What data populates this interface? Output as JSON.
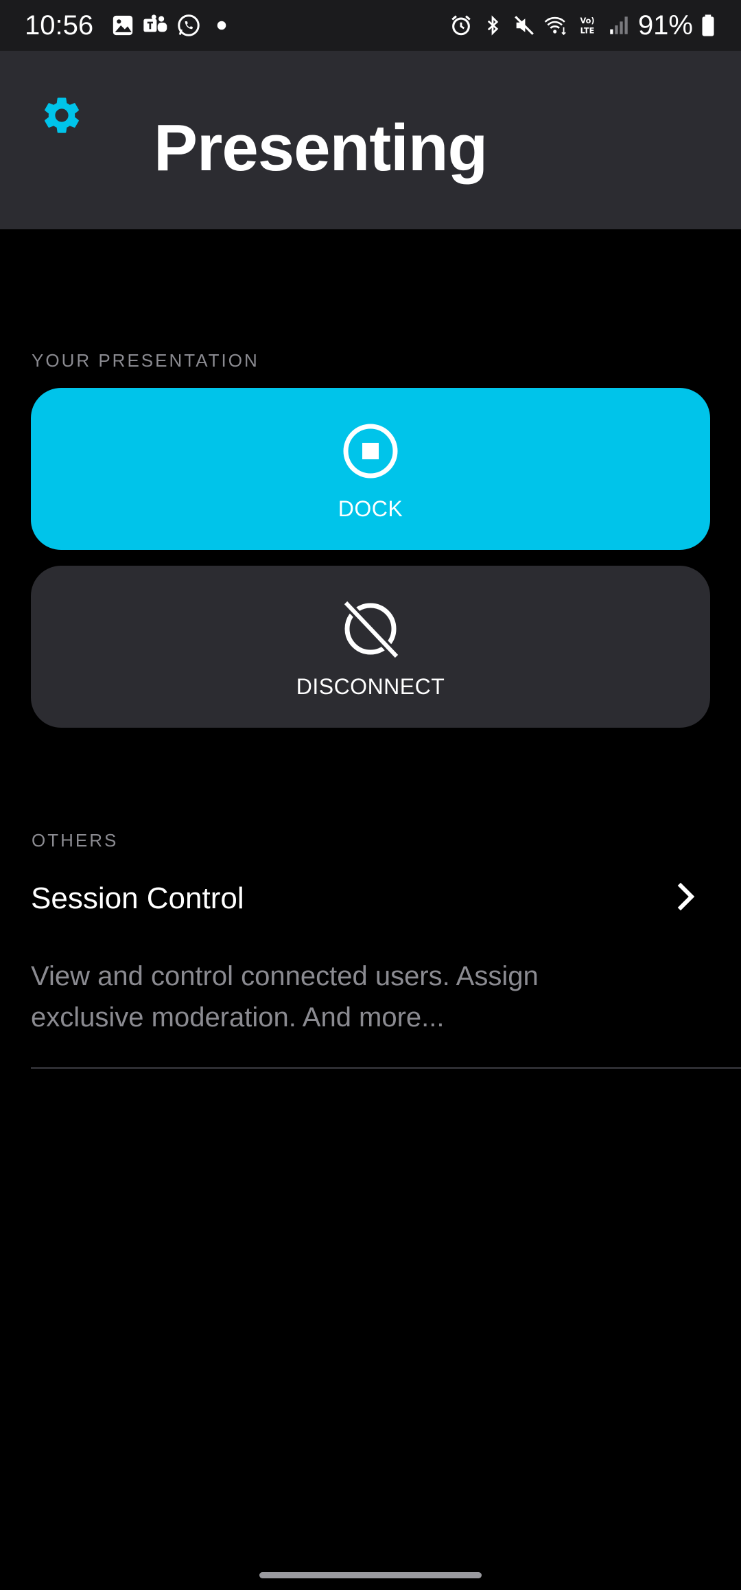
{
  "status_bar": {
    "time": "10:56",
    "battery_percent": "91%",
    "left_icons": [
      "gallery-icon",
      "teams-icon",
      "whatsapp-icon",
      "dot-icon"
    ],
    "right_icons": [
      "alarm-icon",
      "bluetooth-icon",
      "mute-icon",
      "wifi-icon",
      "volte-icon",
      "signal-icon",
      "battery-icon"
    ]
  },
  "header": {
    "title": "Presenting",
    "settings_icon": "gear-icon"
  },
  "your_presentation": {
    "label": "YOUR PRESENTATION",
    "dock": {
      "label": "DOCK",
      "icon": "stop-circle-icon"
    },
    "disconnect": {
      "label": "DISCONNECT",
      "icon": "disconnect-icon"
    }
  },
  "others": {
    "label": "OTHERS",
    "items": [
      {
        "title": "Session Control",
        "description": "View and control connected users. Assign exclusive moderation. And more...",
        "icon": "chevron-right-icon"
      }
    ]
  },
  "colors": {
    "accent": "#00c4ea",
    "header_bg": "#2c2c31",
    "card_bg": "#2c2c31",
    "background": "#000000",
    "muted_text": "#8b8b91"
  }
}
